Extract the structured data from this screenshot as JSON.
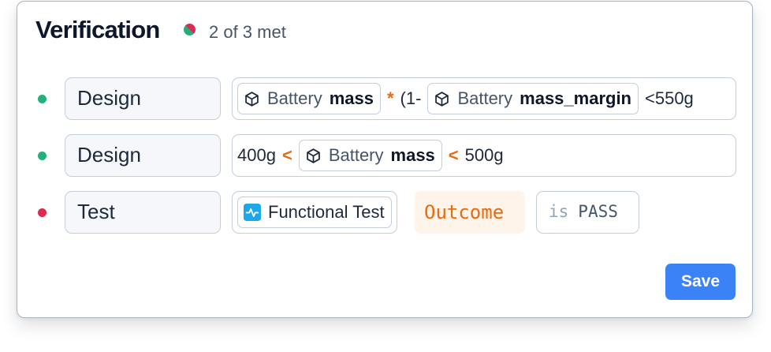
{
  "header": {
    "title": "Verification",
    "status_text": "2 of 3 met",
    "status_colors": {
      "met": "#21b07a",
      "unmet": "#e0294e"
    }
  },
  "requirements": [
    {
      "status": "met",
      "type": "Design",
      "expression": {
        "chip1": {
          "icon": "cube-icon",
          "object": "Battery",
          "property": "mass"
        },
        "op1": "*",
        "text1": "(1-",
        "chip2": {
          "icon": "cube-icon",
          "object": "Battery",
          "property": "mass_margin"
        },
        "tail": "<550g"
      }
    },
    {
      "status": "met",
      "type": "Design",
      "expression": {
        "lower": "400g",
        "op1": "<",
        "chip1": {
          "icon": "cube-icon",
          "object": "Battery",
          "property": "mass"
        },
        "op2": "<",
        "upper": "500g"
      }
    },
    {
      "status": "unmet",
      "type": "Test",
      "test": {
        "icon": "activity-icon",
        "name": "Functional Test"
      },
      "outcome_label": "Outcome",
      "condition": {
        "keyword": "is",
        "value": "PASS"
      }
    }
  ],
  "actions": {
    "save_label": "Save"
  },
  "colors": {
    "accent": "#3b82f6",
    "operator": "#ea6a10",
    "outcome_bg": "#fff4ea"
  }
}
